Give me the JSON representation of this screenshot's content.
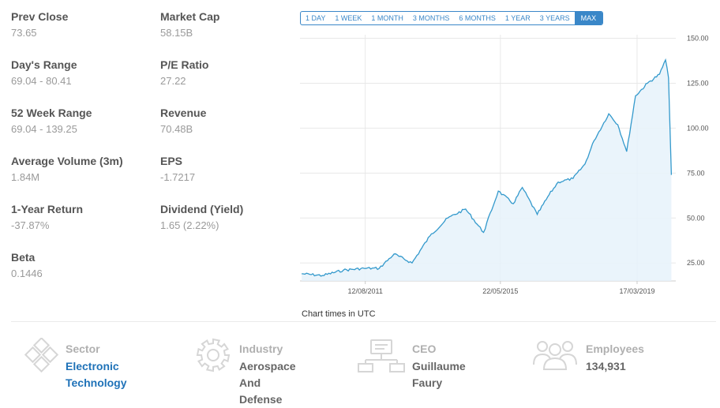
{
  "stats": [
    {
      "label": "Prev Close",
      "value": "73.65"
    },
    {
      "label": "Market Cap",
      "value": "58.15B"
    },
    {
      "label": "Day's Range",
      "value": "69.04 - 80.41"
    },
    {
      "label": "P/E Ratio",
      "value": "27.22"
    },
    {
      "label": "52 Week Range",
      "value": "69.04 - 139.25"
    },
    {
      "label": "Revenue",
      "value": "70.48B"
    },
    {
      "label": "Average Volume (3m)",
      "value": "1.84M"
    },
    {
      "label": "EPS",
      "value": "-1.7217"
    },
    {
      "label": "1-Year Return",
      "value": "-37.87%"
    },
    {
      "label": "Dividend (Yield)",
      "value": "1.65 (2.22%)"
    },
    {
      "label": "Beta",
      "value": "0.1446"
    }
  ],
  "ranges": [
    "1 DAY",
    "1 WEEK",
    "1 MONTH",
    "3 MONTHS",
    "6 MONTHS",
    "1 YEAR",
    "3 YEARS",
    "MAX"
  ],
  "active_range": "MAX",
  "chart_note": "Chart times in UTC",
  "colors": {
    "line": "#3399cc",
    "fill": "#e6f2fa",
    "accent": "#3a87c8",
    "link": "#1f72b8"
  },
  "chart_data": {
    "type": "area",
    "x": [
      "2009-11",
      "2010-06",
      "2011-01",
      "2011-08",
      "2012-01",
      "2012-06",
      "2012-12",
      "2013-06",
      "2013-12",
      "2014-06",
      "2014-12",
      "2015-05",
      "2015-10",
      "2016-01",
      "2016-06",
      "2016-10",
      "2017-01",
      "2017-06",
      "2017-10",
      "2018-01",
      "2018-06",
      "2018-09",
      "2018-12",
      "2019-03",
      "2019-07",
      "2019-11",
      "2020-01",
      "2020-02",
      "2020-03"
    ],
    "values": [
      19,
      18,
      21,
      22,
      22,
      30,
      25,
      40,
      50,
      55,
      42,
      65,
      58,
      67,
      52,
      63,
      70,
      72,
      80,
      93,
      108,
      102,
      87,
      118,
      125,
      130,
      138,
      128,
      74
    ],
    "x_ticks": [
      "12/08/2011",
      "22/05/2015",
      "17/03/2019"
    ],
    "y_ticks": [
      25,
      50,
      75,
      100,
      125,
      150
    ],
    "ylim": [
      15,
      152
    ],
    "grid": true
  },
  "info": [
    {
      "icon": "sector-diamond-icon",
      "title": "Sector",
      "value_lines": [
        "Electronic",
        "Technology"
      ],
      "link": true
    },
    {
      "icon": "industry-gear-icon",
      "title": "Industry",
      "value_lines": [
        "Aerospace And",
        "Defense"
      ],
      "link": false
    },
    {
      "icon": "ceo-org-chart-icon",
      "title": "CEO",
      "value_lines": [
        "Guillaume Faury"
      ],
      "link": false
    },
    {
      "icon": "employees-people-icon",
      "title": "Employees",
      "value_lines": [
        "134,931"
      ],
      "link": false
    }
  ]
}
